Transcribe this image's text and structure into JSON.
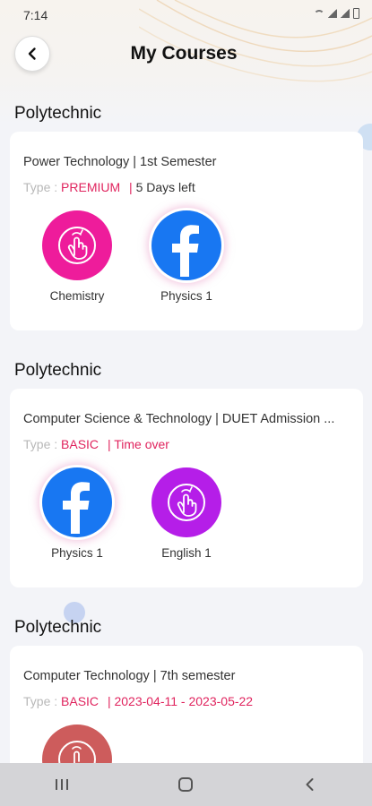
{
  "status_bar": {
    "time": "7:14"
  },
  "header": {
    "title": "My Courses"
  },
  "sections": [
    {
      "heading": "Polytechnic",
      "course_title": "Power Technology | 1st Semester",
      "type_label": "Type :",
      "type_value": "PREMIUM",
      "separator": "|",
      "status": "5 Days left",
      "subjects": [
        {
          "name": "Chemistry",
          "icon": "hand-touch-icon",
          "color": "#ee1c9b"
        },
        {
          "name": "Physics 1",
          "icon": "facebook-icon",
          "color": "#1877f2"
        }
      ]
    },
    {
      "heading": "Polytechnic",
      "course_title": "Computer Science & Technology | DUET Admission ...",
      "type_label": "Type :",
      "type_value": "BASIC",
      "separator": "|",
      "status": "Time over",
      "subjects": [
        {
          "name": "Physics 1",
          "icon": "facebook-icon",
          "color": "#1877f2"
        },
        {
          "name": "English 1",
          "icon": "hand-touch-icon",
          "color": "#b51ee8"
        }
      ]
    },
    {
      "heading": "Polytechnic",
      "course_title": "Computer Technology | 7th semester",
      "type_label": "Type :",
      "type_value": "BASIC",
      "separator": "|",
      "status": "2023-04-11 - 2023-05-22",
      "subjects": [
        {
          "name": "",
          "icon": "hand-touch-icon",
          "color": "#cd5c5c"
        }
      ]
    }
  ],
  "colors": {
    "accent": "#e0245e",
    "background": "#f3f4f8"
  }
}
